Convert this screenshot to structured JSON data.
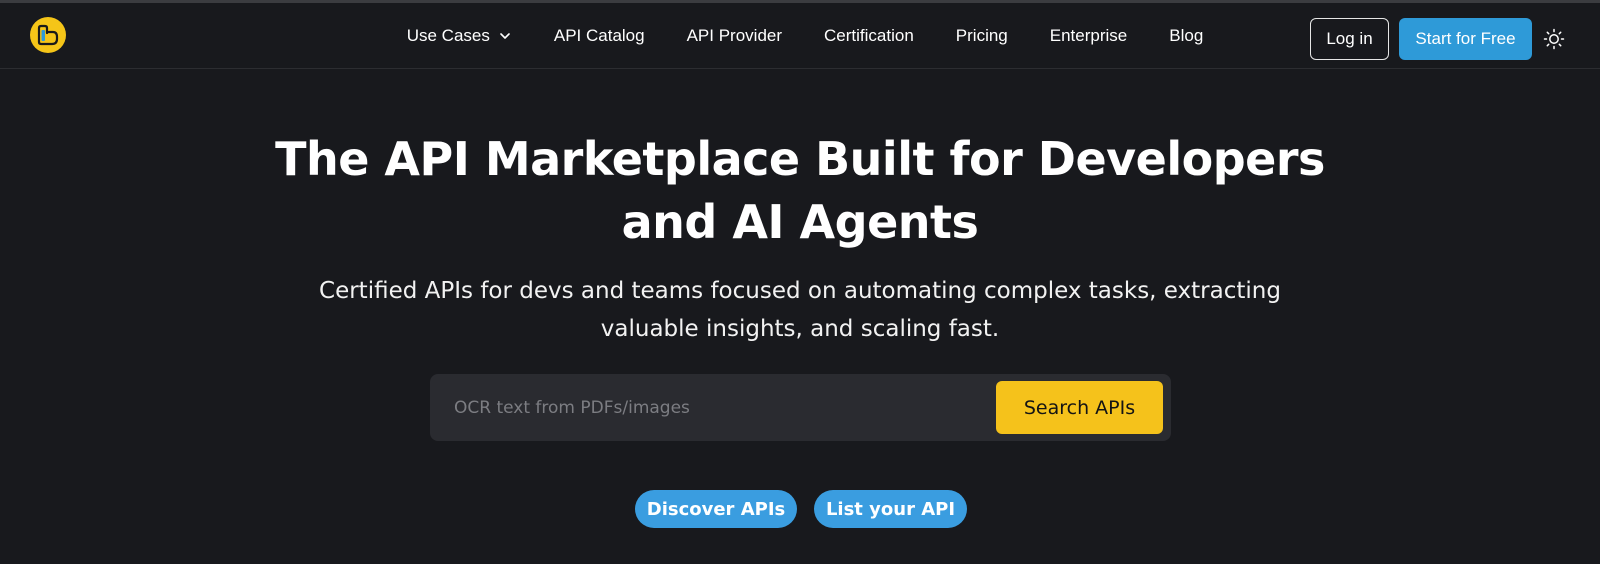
{
  "navbar": {
    "items": [
      {
        "label": "Use Cases",
        "has_dropdown": true
      },
      {
        "label": "API Catalog"
      },
      {
        "label": "API Provider"
      },
      {
        "label": "Certification"
      },
      {
        "label": "Pricing"
      },
      {
        "label": "Enterprise"
      },
      {
        "label": "Blog"
      }
    ],
    "login_label": "Log in",
    "start_label": "Start for Free"
  },
  "hero": {
    "title_line1": "The API Marketplace Built for Developers",
    "title_line2": "and AI Agents",
    "subtitle_line1": "Certified APIs for devs and teams focused on automating complex tasks, extracting",
    "subtitle_line2": "valuable insights, and scaling fast."
  },
  "search": {
    "placeholder": "OCR text from PDFs/images",
    "button_label": "Search APIs"
  },
  "actions": {
    "discover_label": "Discover APIs",
    "list_label": "List your API"
  },
  "colors": {
    "background": "#18191d",
    "accent_yellow": "#f5c21b",
    "accent_blue": "#2e9ad8"
  },
  "icons": {
    "logo": "logo-icon",
    "dropdown": "chevron-down-icon",
    "theme": "sun-icon"
  }
}
